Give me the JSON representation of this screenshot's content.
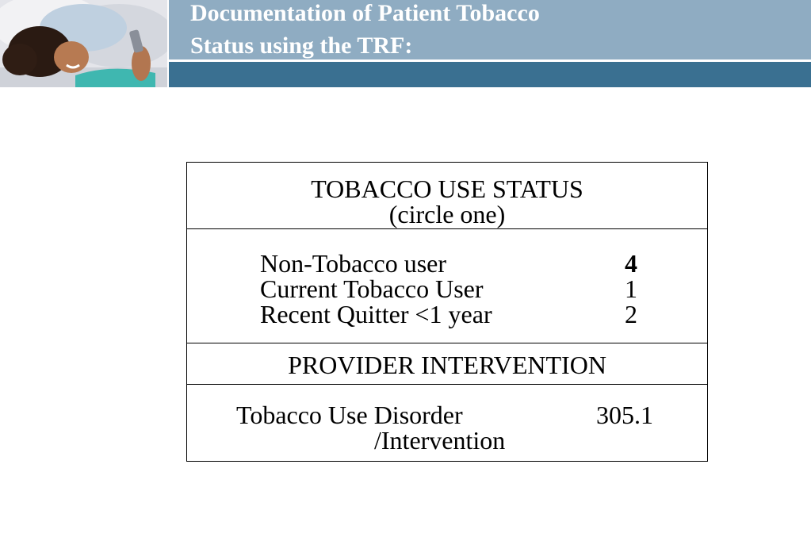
{
  "header": {
    "title_line_1": "Documentation of Patient Tobacco",
    "title_line_2": "Status using the TRF:",
    "band_colors": {
      "title_band": "#8facc2",
      "bottom_band": "#3a7091"
    }
  },
  "trf_form": {
    "status_heading": "TOBACCO USE STATUS",
    "status_subheading": "(circle one)",
    "status_options": [
      {
        "label": "Non-Tobacco user",
        "code": "4",
        "bold": true
      },
      {
        "label": "Current Tobacco User",
        "code": "1",
        "bold": false
      },
      {
        "label": "Recent Quitter <1 year",
        "code": "2",
        "bold": false
      }
    ],
    "intervention_heading": "PROVIDER INTERVENTION",
    "diagnosis": {
      "label_line_1": "Tobacco Use Disorder",
      "label_line_2": "/Intervention",
      "code": "305.1"
    }
  }
}
